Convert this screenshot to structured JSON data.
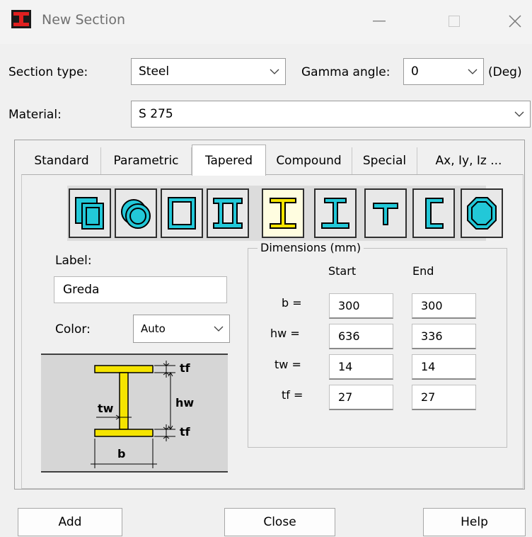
{
  "window": {
    "title": "New Section",
    "minimize_icon": "minimize-icon",
    "maximize_icon": "maximize-icon",
    "close_icon": "close-icon"
  },
  "section_type": {
    "label": "Section type:",
    "value": "Steel"
  },
  "gamma_angle": {
    "label": "Gamma angle:",
    "value": "0",
    "unit": "(Deg)"
  },
  "material": {
    "label": "Material:",
    "value": "S 275"
  },
  "tabs": [
    {
      "label": "Standard"
    },
    {
      "label": "Parametric"
    },
    {
      "label": "Tapered",
      "active": true
    },
    {
      "label": "Compound"
    },
    {
      "label": "Special"
    },
    {
      "label": "Ax, Iy, Iz ..."
    }
  ],
  "shapes": [
    {
      "icon": "rect-hollow-section-icon"
    },
    {
      "icon": "circular-hollow-section-icon"
    },
    {
      "icon": "box-section-icon"
    },
    {
      "icon": "double-i-box-section-icon"
    },
    {
      "icon": "i-section-icon",
      "selected": true
    },
    {
      "icon": "unsymmetric-i-section-icon"
    },
    {
      "icon": "t-section-icon"
    },
    {
      "icon": "channel-section-icon"
    },
    {
      "icon": "octagon-section-icon"
    }
  ],
  "label_field": {
    "label": "Label:",
    "value": "Greda"
  },
  "color_field": {
    "label": "Color:",
    "value": "Auto"
  },
  "dimensions": {
    "title": "Dimensions (mm)",
    "start_header": "Start",
    "end_header": "End",
    "rows": [
      {
        "name": "b =",
        "start": "300",
        "end": "300"
      },
      {
        "name": "hw =",
        "start": "636",
        "end": "336"
      },
      {
        "name": "tw =",
        "start": "14",
        "end": "14"
      },
      {
        "name": "tf =",
        "start": "27",
        "end": "27"
      }
    ]
  },
  "diagram": {
    "tf_top": "tf",
    "tf_bottom": "tf",
    "hw": "hw",
    "tw": "tw",
    "b": "b"
  },
  "buttons": {
    "add": "Add",
    "close": "Close",
    "help": "Help"
  },
  "colors": {
    "flange": "#f5e400",
    "shape_fill": "#22c8d8",
    "background": "#f0f0f0"
  }
}
